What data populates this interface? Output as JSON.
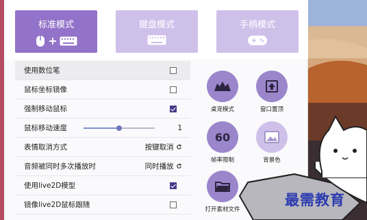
{
  "modes": [
    {
      "label": "标准模式",
      "icon": "mouse-plus-keyboard-icon",
      "active": true
    },
    {
      "label": "键盘模式",
      "icon": "keyboard-icon",
      "active": false
    },
    {
      "label": "手柄模式",
      "icon": "gamepad-icon",
      "active": false
    }
  ],
  "settings": {
    "digital_pen": {
      "label": "使用数位笔",
      "checked": false
    },
    "mirror_coords": {
      "label": "鼠标坐标镜像",
      "checked": false
    },
    "force_move": {
      "label": "强制移动鼠标",
      "checked": true
    },
    "move_speed": {
      "label": "鼠标移动速度",
      "value": "1",
      "slider_fraction": 0.5
    },
    "expression_cancel": {
      "label": "表情取消方式",
      "value": "按键取消"
    },
    "audio_multi": {
      "label": "音频被同时多次播放时",
      "value": "同时播放"
    },
    "use_live2d": {
      "label": "使用live2D模型",
      "checked": true
    },
    "mirror_live2d": {
      "label": "镜像live2D鼠标跟随",
      "checked": false
    }
  },
  "tools": [
    {
      "label": "桌宠模式",
      "icon": "desk-pet-icon"
    },
    {
      "label": "窗口置顶",
      "icon": "pin-window-icon"
    },
    {
      "label": "帧率限制",
      "icon": "fps-60-icon"
    },
    {
      "label": "背景色",
      "icon": "image-icon"
    },
    {
      "label": "打开素材文件",
      "icon": "folder-icon"
    }
  ],
  "watermark": "最需教育",
  "colors": {
    "accent": "#9373c9",
    "accent_light": "#cfc0ea",
    "circle": "#9b86cc",
    "checked": "#4a3a8a",
    "watermark": "#2c3bb0"
  }
}
